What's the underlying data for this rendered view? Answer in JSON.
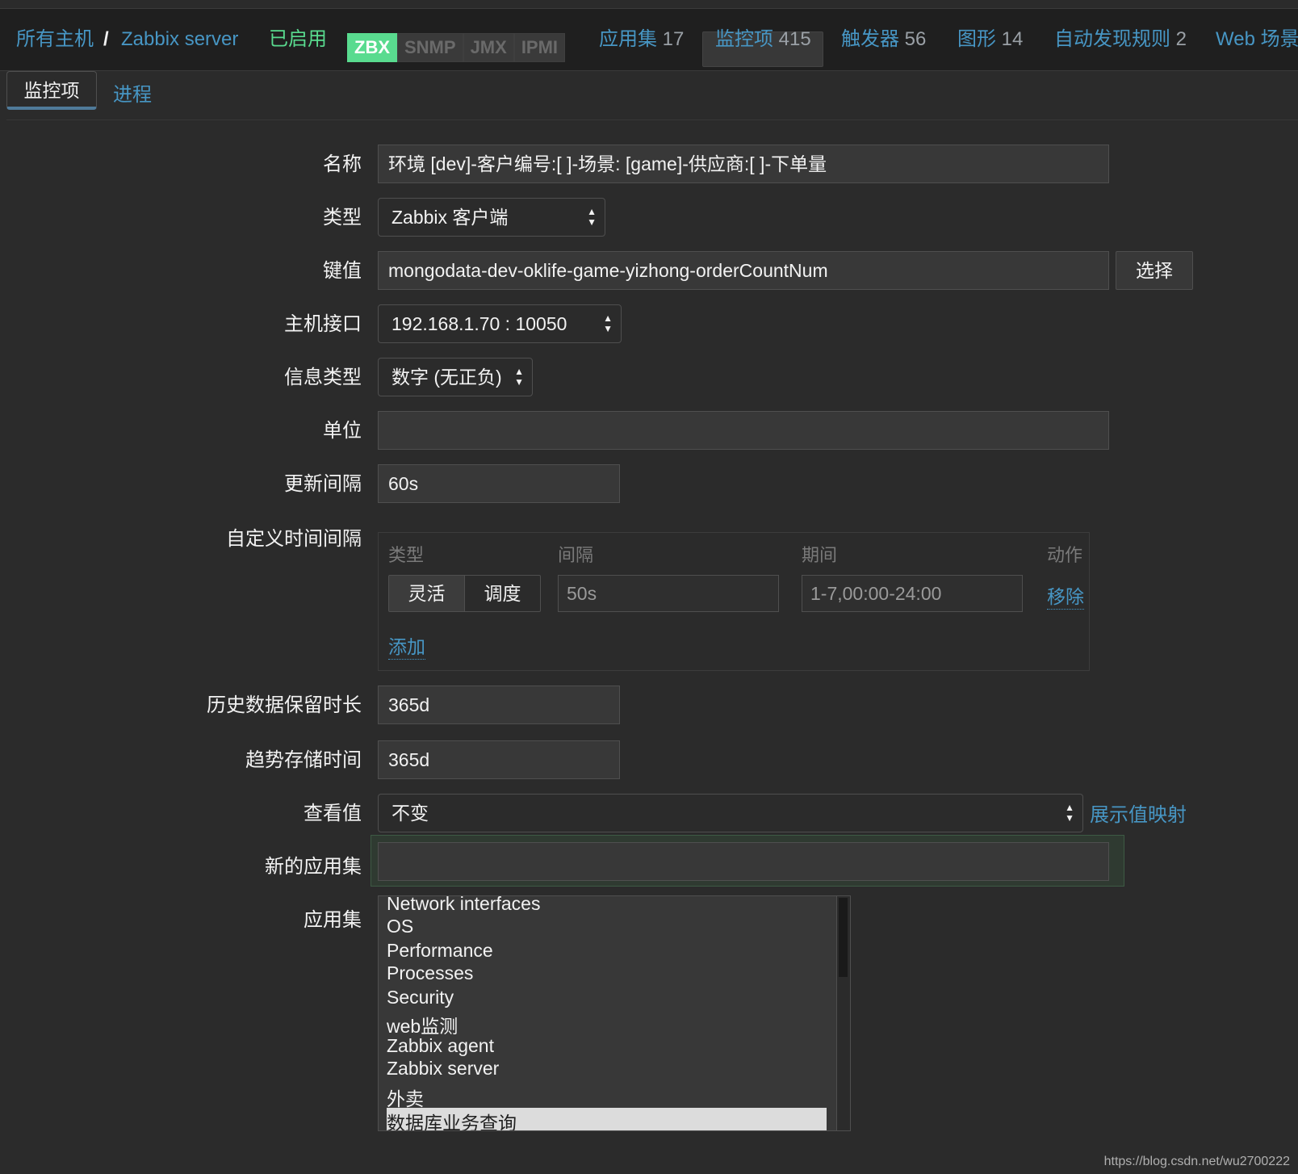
{
  "header": {
    "breadcrumb_all_hosts": "所有主机",
    "breadcrumb_sep": "/",
    "host_name": "Zabbix server",
    "status": "已启用",
    "badges": [
      "ZBX",
      "SNMP",
      "JMX",
      "IPMI"
    ],
    "nav": [
      {
        "label": "应用集",
        "count": "17"
      },
      {
        "label": "监控项",
        "count": "415"
      },
      {
        "label": "触发器",
        "count": "56"
      },
      {
        "label": "图形",
        "count": "14"
      },
      {
        "label": "自动发现规则",
        "count": "2"
      },
      {
        "label": "Web 场景",
        "count": ""
      }
    ]
  },
  "tabs": {
    "active": "监控项",
    "other": "进程"
  },
  "form": {
    "name": {
      "label": "名称",
      "value": "环境 [dev]-客户编号:[ ]-场景: [game]-供应商:[ ]-下单量"
    },
    "type": {
      "label": "类型",
      "value": "Zabbix 客户端"
    },
    "key": {
      "label": "键值",
      "value": "mongodata-dev-oklife-game-yizhong-orderCountNum",
      "button": "选择"
    },
    "interface": {
      "label": "主机接口",
      "value": "192.168.1.70 : 10050"
    },
    "info_type": {
      "label": "信息类型",
      "value": "数字 (无正负)"
    },
    "units": {
      "label": "单位",
      "value": ""
    },
    "update_interval": {
      "label": "更新间隔",
      "value": "60s"
    },
    "custom_intervals": {
      "label": "自定义时间间隔",
      "headers": {
        "type": "类型",
        "interval": "间隔",
        "period": "期间",
        "action": "动作"
      },
      "seg_flexible": "灵活",
      "seg_scheduling": "调度",
      "interval": "50s",
      "period": "1-7,00:00-24:00",
      "remove": "移除",
      "add": "添加"
    },
    "history": {
      "label": "历史数据保留时长",
      "value": "365d"
    },
    "trends": {
      "label": "趋势存储时间",
      "value": "365d"
    },
    "show_value": {
      "label": "查看值",
      "value": "不变",
      "link": "展示值映射"
    },
    "new_app": {
      "label": "新的应用集",
      "value": ""
    },
    "applications": {
      "label": "应用集",
      "items": [
        "Network interfaces",
        "OS",
        "Performance",
        "Processes",
        "Security",
        "web监测",
        "Zabbix agent",
        "Zabbix server",
        "外卖",
        "数据库业务查询"
      ],
      "selected": "数据库业务查询"
    }
  },
  "watermark": "https://blog.csdn.net/wu2700222"
}
